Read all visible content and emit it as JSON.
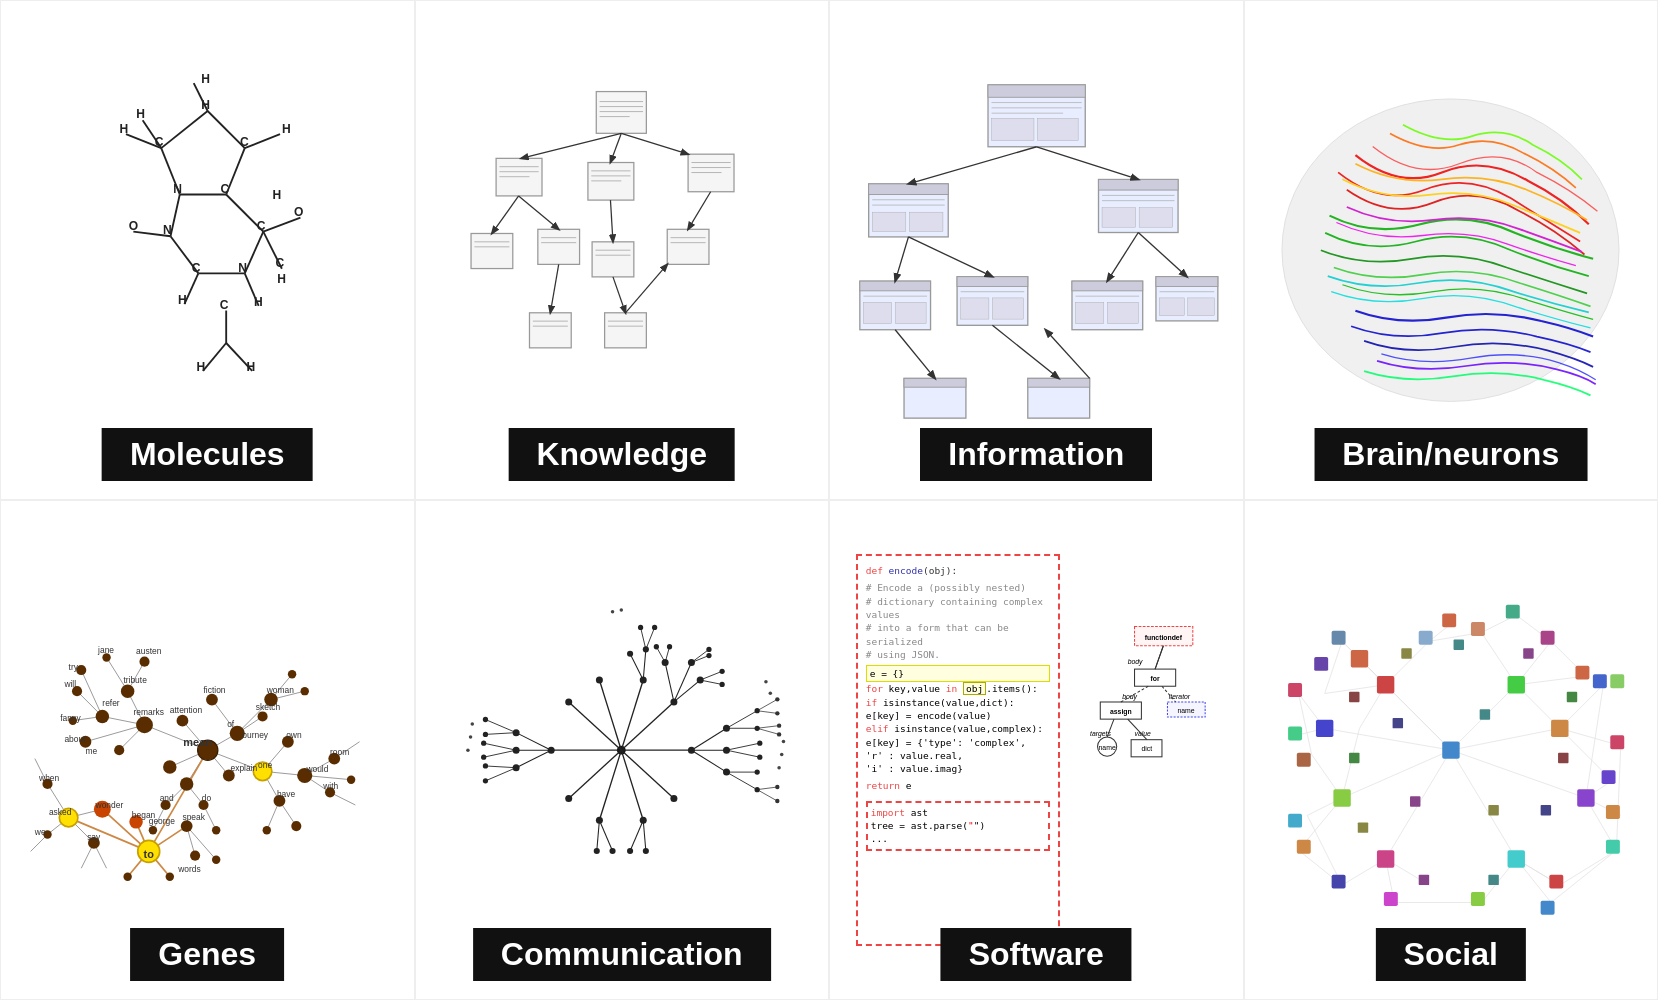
{
  "cells": [
    {
      "id": "molecules",
      "label": "Molecules",
      "row": 0,
      "col": 0
    },
    {
      "id": "knowledge",
      "label": "Knowledge",
      "row": 0,
      "col": 1
    },
    {
      "id": "information",
      "label": "Information",
      "row": 0,
      "col": 2
    },
    {
      "id": "brain",
      "label": "Brain/neurons",
      "row": 0,
      "col": 3
    },
    {
      "id": "genes",
      "label": "Genes",
      "row": 1,
      "col": 0
    },
    {
      "id": "communication",
      "label": "Communication",
      "row": 1,
      "col": 1
    },
    {
      "id": "software",
      "label": "Software",
      "row": 1,
      "col": 2
    },
    {
      "id": "social",
      "label": "Social",
      "row": 1,
      "col": 3
    }
  ]
}
